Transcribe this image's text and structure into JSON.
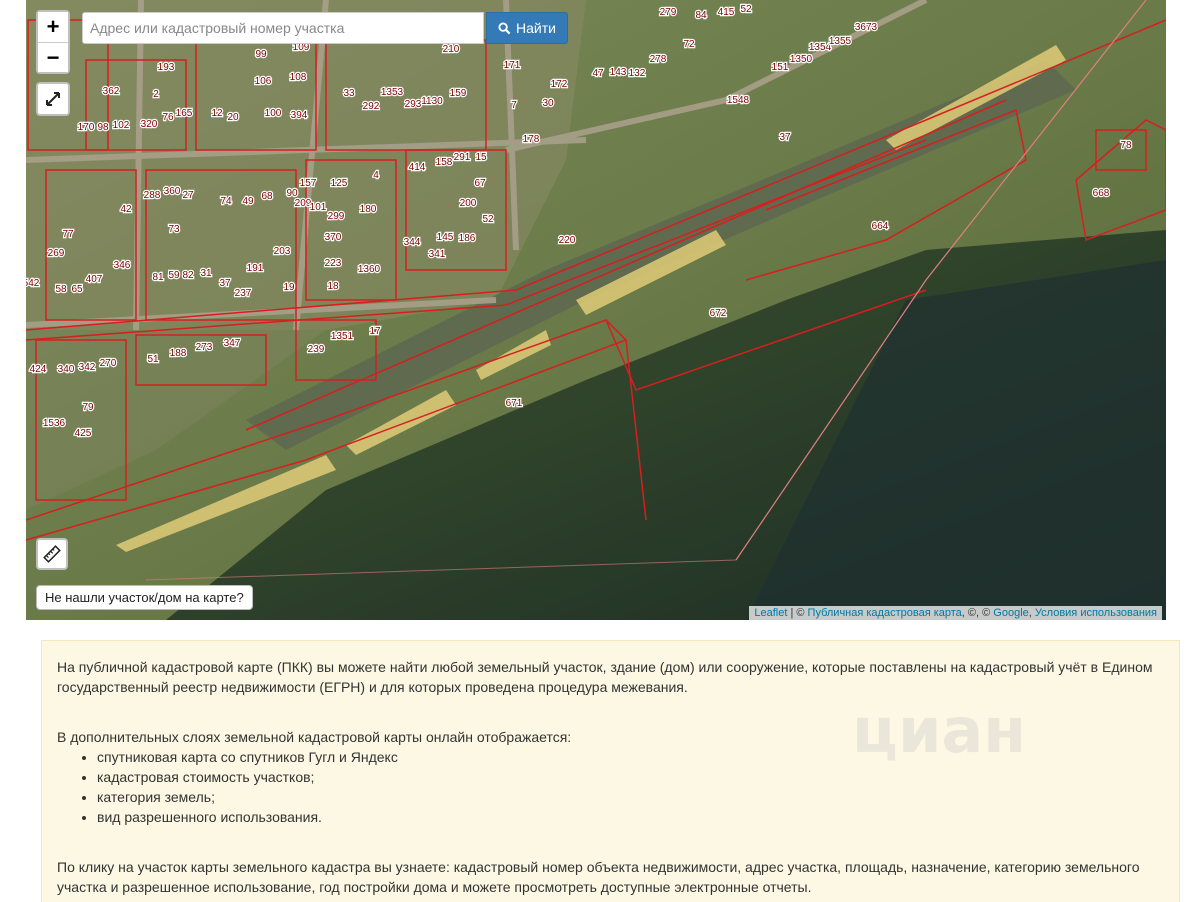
{
  "map": {
    "search": {
      "placeholder": "Адрес или кадастровый номер участка",
      "button_label": "Найти"
    },
    "zoom_in_label": "+",
    "zoom_out_label": "−",
    "not_found_label": "Не нашли участок/дом на карте?",
    "attribution": {
      "leaflet": "Leaflet",
      "sep1": " | © ",
      "pkk": "Публичная кадастровая карта",
      "sep2": ", ©, © ",
      "google": "Google",
      "sep3": ", ",
      "terms": "Условия использования"
    },
    "plot_numbers": [
      "193",
      "99",
      "109",
      "210",
      "171",
      "279",
      "84",
      "415",
      "52",
      "2",
      "106",
      "108",
      "33",
      "292",
      "1353",
      "293",
      "1130",
      "159",
      "7",
      "30",
      "172",
      "47",
      "143",
      "132",
      "278",
      "72",
      "362",
      "170",
      "98",
      "102",
      "320",
      "76",
      "165",
      "12",
      "20",
      "100",
      "394",
      "178",
      "1548",
      "151",
      "1350",
      "1354",
      "1355",
      "3673",
      "37",
      "78",
      "668",
      "664",
      "672",
      "671",
      "414",
      "158",
      "291",
      "15",
      "67",
      "200",
      "52",
      "220",
      "42",
      "288",
      "360",
      "27",
      "74",
      "49",
      "68",
      "90",
      "157",
      "209",
      "101",
      "125",
      "4",
      "180",
      "299",
      "370",
      "223",
      "1360",
      "344",
      "145",
      "186",
      "341",
      "77",
      "269",
      "346",
      "73",
      "81",
      "59",
      "82",
      "31",
      "37",
      "237",
      "191",
      "203",
      "19",
      "18",
      "17",
      "1351",
      "239",
      "542",
      "58",
      "65",
      "407",
      "51",
      "188",
      "273",
      "347",
      "424",
      "340",
      "342",
      "270",
      "79",
      "1536",
      "425"
    ]
  },
  "info": {
    "p1": "На публичной кадастровой карте (ПКК) вы можете найти любой земельный участок, здание (дом) или сооружение, которые поставлены на кадастровый учёт в Едином государственный реестр недвижимости (ЕГРН) и для которых проведена процедура межевания.",
    "p2": "В дополнительных слоях земельной кадастровой карты онлайн отображается:",
    "items": [
      "спутниковая карта со спутников Гугл и Яндекс",
      "кадастровая стоимость участков;",
      "категория земель;",
      "вид разрешенного использования."
    ],
    "p3": "По клику на участок карты земельного кадастра вы узнаете: кадастровый номер объекта недвижимости, адрес участка, площадь, назначение, категорию земельного участка и разрешенное использование, год постройки дома и можете просмотреть доступные электронные отчеты.",
    "watermark": "циан"
  },
  "colors": {
    "accent": "#337ab7",
    "parcel": "#d81e1e",
    "info_bg": "#fcf8e3"
  }
}
